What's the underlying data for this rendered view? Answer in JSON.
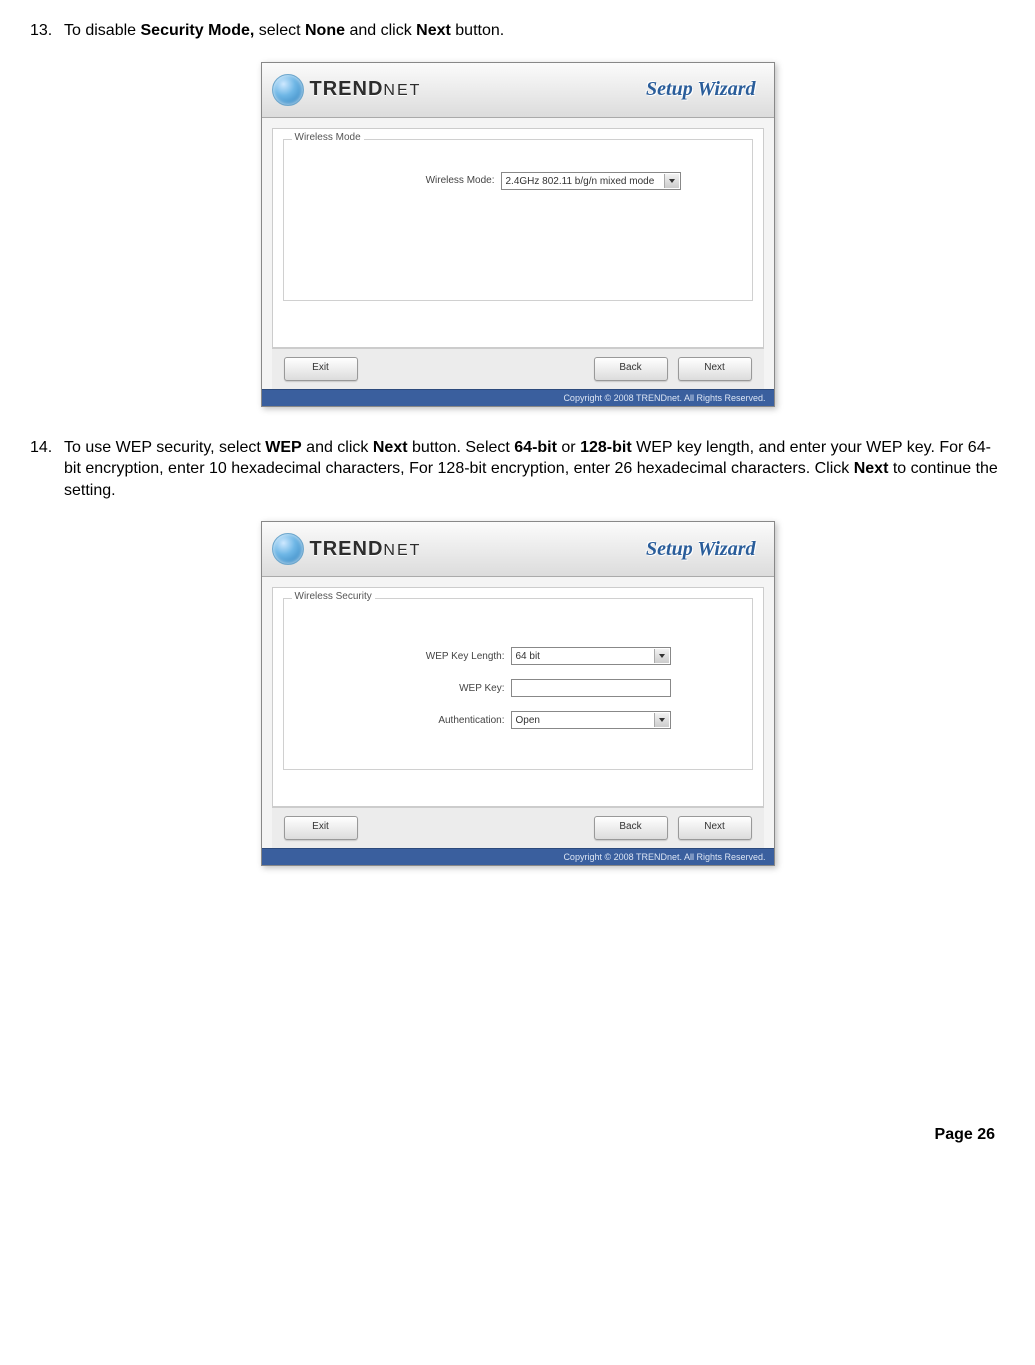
{
  "steps": {
    "s13": {
      "number": "13.",
      "text_before_b1": "To disable ",
      "b1": "Security Mode,",
      "text_mid1": " select ",
      "b2": "None",
      "text_mid2": " and click ",
      "b3": "Next",
      "text_after": " button."
    },
    "s14": {
      "number": "14.",
      "t1": "To use WEP security, select ",
      "b1": "WEP",
      "t2": " and click ",
      "b2": "Next",
      "t3": " button. Select ",
      "b3": "64-bit",
      "t4": " or ",
      "b4": "128-bit",
      "t5": " WEP key length, and enter your WEP key. For 64-bit encryption, enter 10 hexadecimal characters, For 128-bit encryption, enter 26 hexadecimal characters. Click ",
      "b5": "Next",
      "t6": " to continue the setting."
    }
  },
  "wizard_common": {
    "brand": "TRENDNET",
    "title": "Setup Wizard",
    "copyright": "Copyright © 2008 TRENDnet. All Rights Reserved.",
    "buttons": {
      "exit": "Exit",
      "back": "Back",
      "next": "Next"
    }
  },
  "wizard1": {
    "group_title": "Wireless Mode",
    "mode_label": "Wireless Mode:",
    "mode_value": "2.4GHz 802.11 b/g/n mixed mode"
  },
  "wizard2": {
    "group_title": "Wireless Security",
    "keylen_label": "WEP Key Length:",
    "keylen_value": "64 bit",
    "key_label": "WEP Key:",
    "key_value": "",
    "auth_label": "Authentication:",
    "auth_value": "Open"
  },
  "page_footer": "Page  26"
}
